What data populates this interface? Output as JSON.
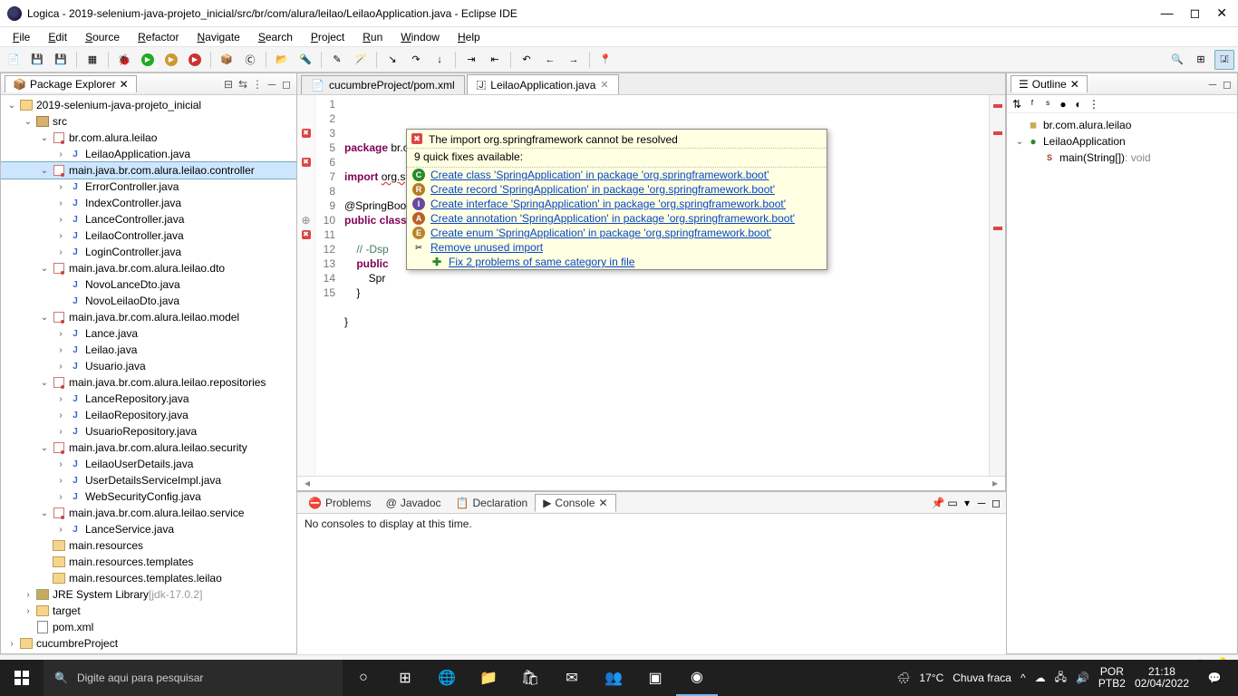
{
  "title": "Logica - 2019-selenium-java-projeto_inicial/src/br/com/alura/leilao/LeilaoApplication.java - Eclipse IDE",
  "menu": [
    "File",
    "Edit",
    "Source",
    "Refactor",
    "Navigate",
    "Search",
    "Project",
    "Run",
    "Window",
    "Help"
  ],
  "packageExplorer": {
    "title": "Package Explorer",
    "tree": [
      {
        "d": 0,
        "tw": "v",
        "ico": "proj",
        "label": "2019-selenium-java-projeto_inicial"
      },
      {
        "d": 1,
        "tw": "v",
        "ico": "src",
        "label": "src"
      },
      {
        "d": 2,
        "tw": "v",
        "ico": "pkg",
        "label": "br.com.alura.leilao"
      },
      {
        "d": 3,
        "tw": ">",
        "ico": "java",
        "label": "LeilaoApplication.java"
      },
      {
        "d": 2,
        "tw": "v",
        "ico": "pkg",
        "label": "main.java.br.com.alura.leilao.controller",
        "sel": true
      },
      {
        "d": 3,
        "tw": ">",
        "ico": "java",
        "label": "ErrorController.java"
      },
      {
        "d": 3,
        "tw": ">",
        "ico": "java",
        "label": "IndexController.java"
      },
      {
        "d": 3,
        "tw": ">",
        "ico": "java",
        "label": "LanceController.java"
      },
      {
        "d": 3,
        "tw": ">",
        "ico": "java",
        "label": "LeilaoController.java"
      },
      {
        "d": 3,
        "tw": ">",
        "ico": "java",
        "label": "LoginController.java"
      },
      {
        "d": 2,
        "tw": "v",
        "ico": "pkg",
        "label": "main.java.br.com.alura.leilao.dto"
      },
      {
        "d": 3,
        "tw": "",
        "ico": "java",
        "label": "NovoLanceDto.java"
      },
      {
        "d": 3,
        "tw": "",
        "ico": "java",
        "label": "NovoLeilaoDto.java"
      },
      {
        "d": 2,
        "tw": "v",
        "ico": "pkg",
        "label": "main.java.br.com.alura.leilao.model"
      },
      {
        "d": 3,
        "tw": ">",
        "ico": "java",
        "label": "Lance.java"
      },
      {
        "d": 3,
        "tw": ">",
        "ico": "java",
        "label": "Leilao.java"
      },
      {
        "d": 3,
        "tw": ">",
        "ico": "java",
        "label": "Usuario.java"
      },
      {
        "d": 2,
        "tw": "v",
        "ico": "pkg",
        "label": "main.java.br.com.alura.leilao.repositories"
      },
      {
        "d": 3,
        "tw": ">",
        "ico": "java",
        "label": "LanceRepository.java"
      },
      {
        "d": 3,
        "tw": ">",
        "ico": "java",
        "label": "LeilaoRepository.java"
      },
      {
        "d": 3,
        "tw": ">",
        "ico": "java",
        "label": "UsuarioRepository.java"
      },
      {
        "d": 2,
        "tw": "v",
        "ico": "pkg",
        "label": "main.java.br.com.alura.leilao.security"
      },
      {
        "d": 3,
        "tw": ">",
        "ico": "java",
        "label": "LeilaoUserDetails.java"
      },
      {
        "d": 3,
        "tw": ">",
        "ico": "java",
        "label": "UserDetailsServiceImpl.java"
      },
      {
        "d": 3,
        "tw": ">",
        "ico": "java",
        "label": "WebSecurityConfig.java"
      },
      {
        "d": 2,
        "tw": "v",
        "ico": "pkg",
        "label": "main.java.br.com.alura.leilao.service"
      },
      {
        "d": 3,
        "tw": ">",
        "ico": "java",
        "label": "LanceService.java"
      },
      {
        "d": 2,
        "tw": "",
        "ico": "folder",
        "label": "main.resources"
      },
      {
        "d": 2,
        "tw": "",
        "ico": "folder",
        "label": "main.resources.templates"
      },
      {
        "d": 2,
        "tw": "",
        "ico": "folder",
        "label": "main.resources.templates.leilao"
      },
      {
        "d": 1,
        "tw": ">",
        "ico": "jar",
        "label": "JRE System Library",
        "suffix": "[jdk-17.0.2]"
      },
      {
        "d": 1,
        "tw": ">",
        "ico": "folder",
        "label": "target"
      },
      {
        "d": 1,
        "tw": "",
        "ico": "xml",
        "label": "pom.xml"
      },
      {
        "d": 0,
        "tw": ">",
        "ico": "proj",
        "label": "cucumbreProject"
      }
    ]
  },
  "editor": {
    "tabs": [
      {
        "label": "cucumbreProject/pom.xml",
        "active": false,
        "icon": "xml"
      },
      {
        "label": "LeilaoApplication.java",
        "active": true,
        "icon": "java",
        "close": true
      }
    ],
    "lines": [
      {
        "n": 1,
        "html": "<span class='kw'>package</span> br.com.alura.leilao;"
      },
      {
        "n": 2,
        "html": ""
      },
      {
        "n": 3,
        "err": true,
        "fold": true,
        "html": "<span class='kw'>import</span> <span class='err'>org.springframework.boot.SpringApplication</span>;"
      },
      {
        "n": 5,
        "html": ""
      },
      {
        "n": 6,
        "err": true,
        "html": "@SpringBoot"
      },
      {
        "n": 7,
        "html": "<span class='kw'>public class</span>"
      },
      {
        "n": 8,
        "html": ""
      },
      {
        "n": 9,
        "html": "    <span class='cm'>// -Dsp</span>"
      },
      {
        "n": 10,
        "fold": true,
        "html": "    <span class='kw'>public</span> "
      },
      {
        "n": 11,
        "err": true,
        "html": "        Spr"
      },
      {
        "n": 12,
        "html": "    }"
      },
      {
        "n": 13,
        "html": ""
      },
      {
        "n": 14,
        "html": "}"
      },
      {
        "n": 15,
        "html": ""
      }
    ]
  },
  "quickfix": {
    "error": "The import org.springframework cannot be resolved",
    "sub": "9 quick fixes available:",
    "items": [
      {
        "ic": "C",
        "t": "Create class 'SpringApplication' in package 'org.springframework.boot'"
      },
      {
        "ic": "R",
        "t": "Create record 'SpringApplication' in package 'org.springframework.boot'"
      },
      {
        "ic": "I",
        "t": "Create interface 'SpringApplication' in package 'org.springframework.boot'"
      },
      {
        "ic": "A",
        "t": "Create annotation 'SpringApplication' in package 'org.springframework.boot'"
      },
      {
        "ic": "E",
        "t": "Create enum 'SpringApplication' in package 'org.springframework.boot'"
      },
      {
        "ic": "rm",
        "t": "Remove unused import"
      },
      {
        "ic": "fix",
        "t": "Fix 2 problems of same category in file",
        "indent": true
      }
    ]
  },
  "outline": {
    "title": "Outline",
    "items": [
      {
        "d": 0,
        "ico": "pkg",
        "label": "br.com.alura.leilao"
      },
      {
        "d": 0,
        "tw": "v",
        "ico": "class",
        "label": "LeilaoApplication"
      },
      {
        "d": 1,
        "ico": "meth",
        "label": "main(String[])",
        "type": " : void"
      }
    ]
  },
  "bottom": {
    "tabs": [
      {
        "label": "Problems",
        "icon": "err"
      },
      {
        "label": "Javadoc",
        "icon": "@"
      },
      {
        "label": "Declaration",
        "icon": "decl"
      },
      {
        "label": "Console",
        "icon": "cons",
        "active": true,
        "close": true
      }
    ],
    "console": "No consoles to display at this time."
  },
  "taskbar": {
    "searchPlaceholder": "Digite aqui para pesquisar",
    "weather": {
      "temp": "17°C",
      "cond": "Chuva fraca"
    },
    "lang": {
      "l1": "POR",
      "l2": "PTB2"
    },
    "clock": {
      "time": "21:18",
      "date": "02/04/2022"
    }
  }
}
